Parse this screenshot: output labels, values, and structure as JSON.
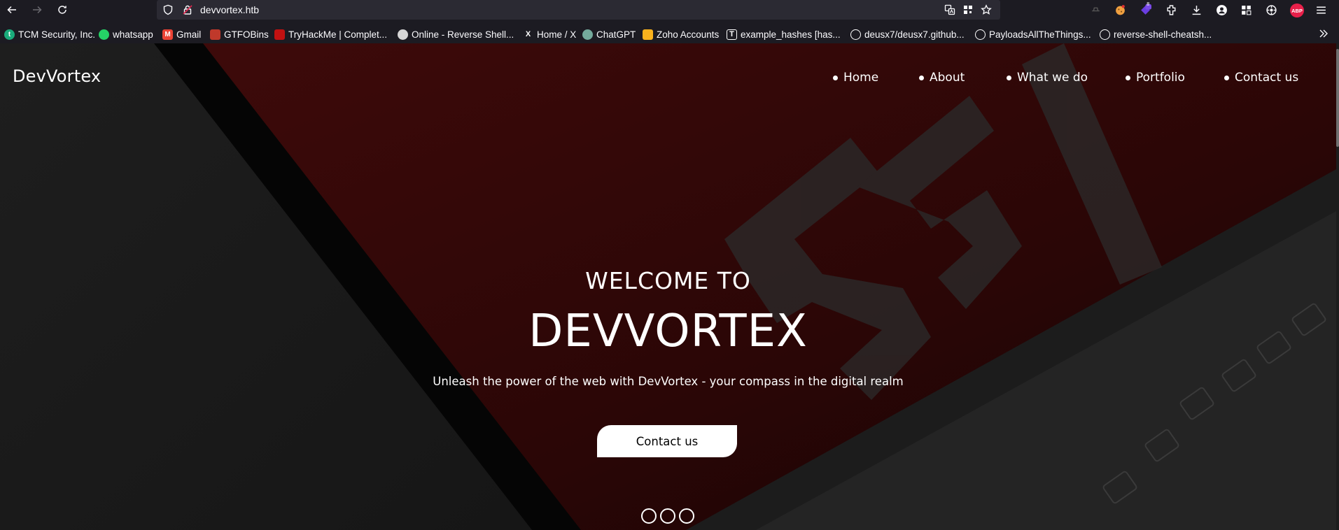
{
  "browser": {
    "url": "devvortex.htb",
    "extension_badge": "8",
    "adblock_label": "ABP",
    "bookmarks": [
      {
        "label": "TCM Security, Inc.",
        "icon": "tcm-icon",
        "color": "#1aab7b",
        "glyph": "t"
      },
      {
        "label": "whatsapp",
        "icon": "whatsapp-icon",
        "color": "#25d366",
        "glyph": ""
      },
      {
        "label": "Gmail",
        "icon": "gmail-icon",
        "color": "#ea4335",
        "glyph": "M"
      },
      {
        "label": "GTFOBins",
        "icon": "gtfobins-icon",
        "color": "#c0392b",
        "glyph": ""
      },
      {
        "label": "TryHackMe | Complet...",
        "icon": "tryhackme-icon",
        "color": "#c11111",
        "glyph": ""
      },
      {
        "label": "Online - Reverse Shell...",
        "icon": "skull-icon",
        "color": "#d6d6d6",
        "glyph": ""
      },
      {
        "label": "Home / X",
        "icon": "x-icon",
        "color": "#ffffff",
        "glyph": "X"
      },
      {
        "label": "ChatGPT",
        "icon": "chatgpt-icon",
        "color": "#74aa9c",
        "glyph": ""
      },
      {
        "label": "Zoho Accounts",
        "icon": "zoho-icon",
        "color": "#f9b21d",
        "glyph": ""
      },
      {
        "label": "example_hashes [has...",
        "icon": "hashcat-icon",
        "color": "#ffffff",
        "glyph": "T"
      },
      {
        "label": "deusx7/deusx7.github...",
        "icon": "github-icon",
        "color": "#ffffff",
        "glyph": ""
      },
      {
        "label": "PayloadsAllTheThings...",
        "icon": "globe-icon",
        "color": "#ffffff",
        "glyph": ""
      },
      {
        "label": "reverse-shell-cheatsh...",
        "icon": "globe-icon",
        "color": "#ffffff",
        "glyph": ""
      }
    ]
  },
  "site": {
    "brand": "DevVortex",
    "nav": [
      "Home",
      "About",
      "What we do",
      "Portfolio",
      "Contact us"
    ],
    "hero": {
      "welcome": "WELCOME TO",
      "title": "DEVVORTEX",
      "tagline": "Unleash the power of the web with DevVortex - your compass in the digital realm",
      "cta_label": "Contact us",
      "slides": 3
    }
  },
  "colors": {
    "accent_red": "#3a0808",
    "cta_bg": "#ffffff",
    "chrome_bg": "#1c1b22",
    "urlbar_bg": "#2b2a33"
  }
}
